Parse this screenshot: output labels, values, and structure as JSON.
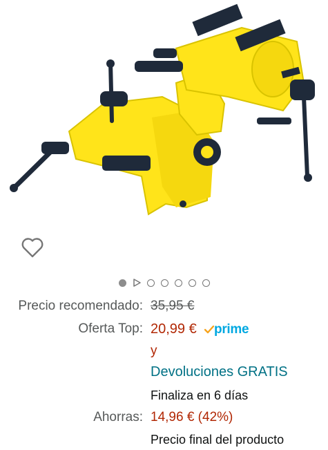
{
  "product": {
    "image_icon": "bench-vise-image",
    "wishlist_icon": "heart-outline-icon",
    "carousel": {
      "total_dots": 7,
      "active_index": 0,
      "video_index": 1
    }
  },
  "pricing": {
    "recommended_label": "Precio recomendado:",
    "recommended_value": "35,95 €",
    "offer_label": "Oferta Top:",
    "offer_value": "20,99 €",
    "prime_label": "prime",
    "and_text": "y",
    "returns_text": "Devoluciones GRATIS",
    "ends_text": "Finaliza en 6 días",
    "savings_label": "Ahorras:",
    "savings_value": "14,96 € (42%)",
    "final_price_text": "Precio final del producto"
  },
  "colors": {
    "price_red": "#B12704",
    "link_teal": "#007185",
    "prime_blue": "#00A8E1",
    "prime_check": "#F7A31C",
    "vise_yellow": "#FFE41A",
    "vise_dark": "#1f2a3a"
  }
}
